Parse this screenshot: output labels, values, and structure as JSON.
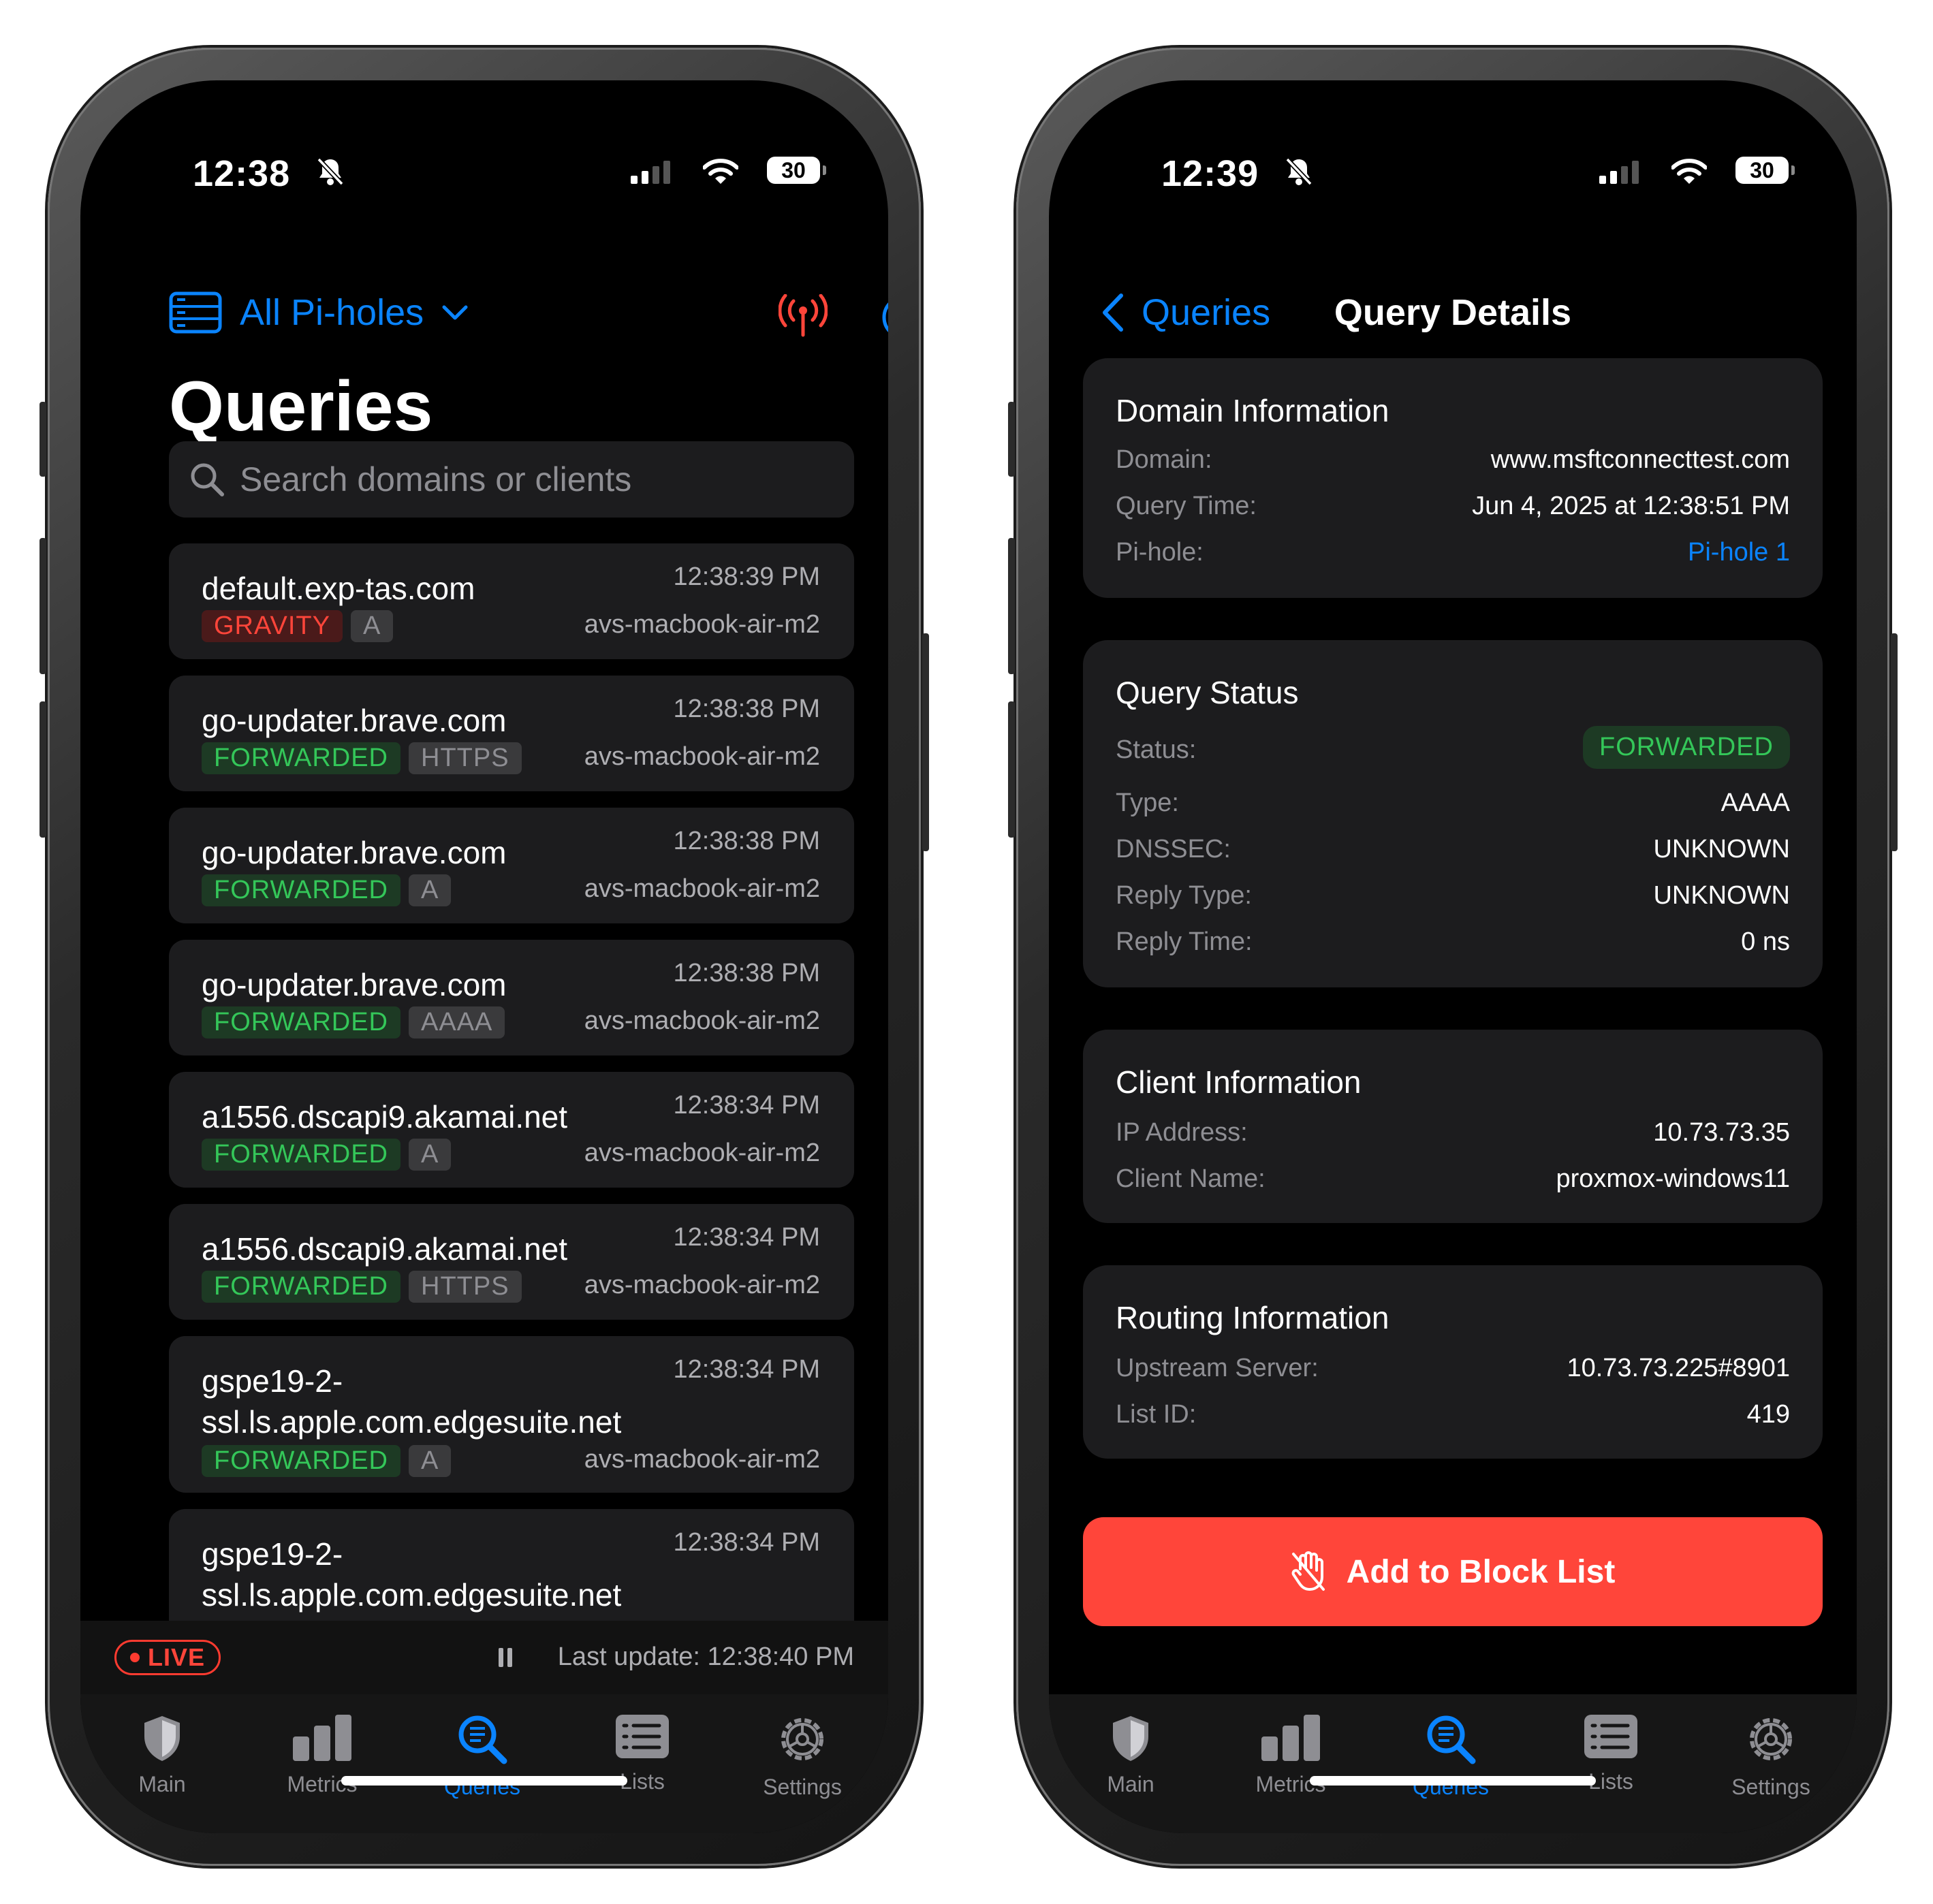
{
  "left": {
    "status_time": "12:38",
    "battery": "30",
    "pihole_selector": "All Pi-holes",
    "title": "Queries",
    "search_placeholder": "Search domains or clients",
    "queries": [
      {
        "domain": "default.exp-tas.com",
        "time": "12:38:39 PM",
        "status": "GRAVITY",
        "type": "A",
        "client": "avs-macbook-air-m2"
      },
      {
        "domain": "go-updater.brave.com",
        "time": "12:38:38 PM",
        "status": "FORWARDED",
        "type": "HTTPS",
        "client": "avs-macbook-air-m2"
      },
      {
        "domain": "go-updater.brave.com",
        "time": "12:38:38 PM",
        "status": "FORWARDED",
        "type": "A",
        "client": "avs-macbook-air-m2"
      },
      {
        "domain": "go-updater.brave.com",
        "time": "12:38:38 PM",
        "status": "FORWARDED",
        "type": "AAAA",
        "client": "avs-macbook-air-m2"
      },
      {
        "domain": "a1556.dscapi9.akamai.net",
        "time": "12:38:34 PM",
        "status": "FORWARDED",
        "type": "A",
        "client": "avs-macbook-air-m2"
      },
      {
        "domain": "a1556.dscapi9.akamai.net",
        "time": "12:38:34 PM",
        "status": "FORWARDED",
        "type": "HTTPS",
        "client": "avs-macbook-air-m2"
      },
      {
        "domain_line1": "gspe19-2-",
        "domain_line2": "ssl.ls.apple.com.edgesuite.net",
        "time": "12:38:34 PM",
        "status": "FORWARDED",
        "type": "A",
        "client": "avs-macbook-air-m2"
      },
      {
        "domain_line1": "gspe19-2-",
        "domain_line2": "ssl.ls.apple.com.edgesuite.net",
        "time": "12:38:34 PM"
      }
    ],
    "live_label": "LIVE",
    "last_update": "Last update: 12:38:40 PM"
  },
  "right": {
    "status_time": "12:39",
    "battery": "30",
    "back_label": "Queries",
    "nav_title": "Query Details",
    "domain_info": {
      "title": "Domain Information",
      "domain_label": "Domain:",
      "domain": "www.msftconnecttest.com",
      "time_label": "Query Time:",
      "time": "Jun 4, 2025 at 12:38:51 PM",
      "pihole_label": "Pi-hole:",
      "pihole": "Pi-hole 1"
    },
    "query_status": {
      "title": "Query Status",
      "status_label": "Status:",
      "status": "FORWARDED",
      "type_label": "Type:",
      "type": "AAAA",
      "dnssec_label": "DNSSEC:",
      "dnssec": "UNKNOWN",
      "reply_type_label": "Reply Type:",
      "reply_type": "UNKNOWN",
      "reply_time_label": "Reply Time:",
      "reply_time": "0 ns"
    },
    "client_info": {
      "title": "Client Information",
      "ip_label": "IP Address:",
      "ip": "10.73.73.35",
      "name_label": "Client Name:",
      "name": "proxmox-windows11"
    },
    "routing_info": {
      "title": "Routing Information",
      "upstream_label": "Upstream Server:",
      "upstream": "10.73.73.225#8901",
      "list_label": "List ID:",
      "list_id": "419"
    },
    "block_button": "Add to Block List"
  },
  "tabs": [
    "Main",
    "Metrics",
    "Queries",
    "Lists",
    "Settings"
  ],
  "active_tab": "Queries",
  "colors": {
    "accent": "#0a84ff",
    "forwarded": "#34c759",
    "gravity": "#ff453a",
    "block_button": "#ff453a"
  }
}
